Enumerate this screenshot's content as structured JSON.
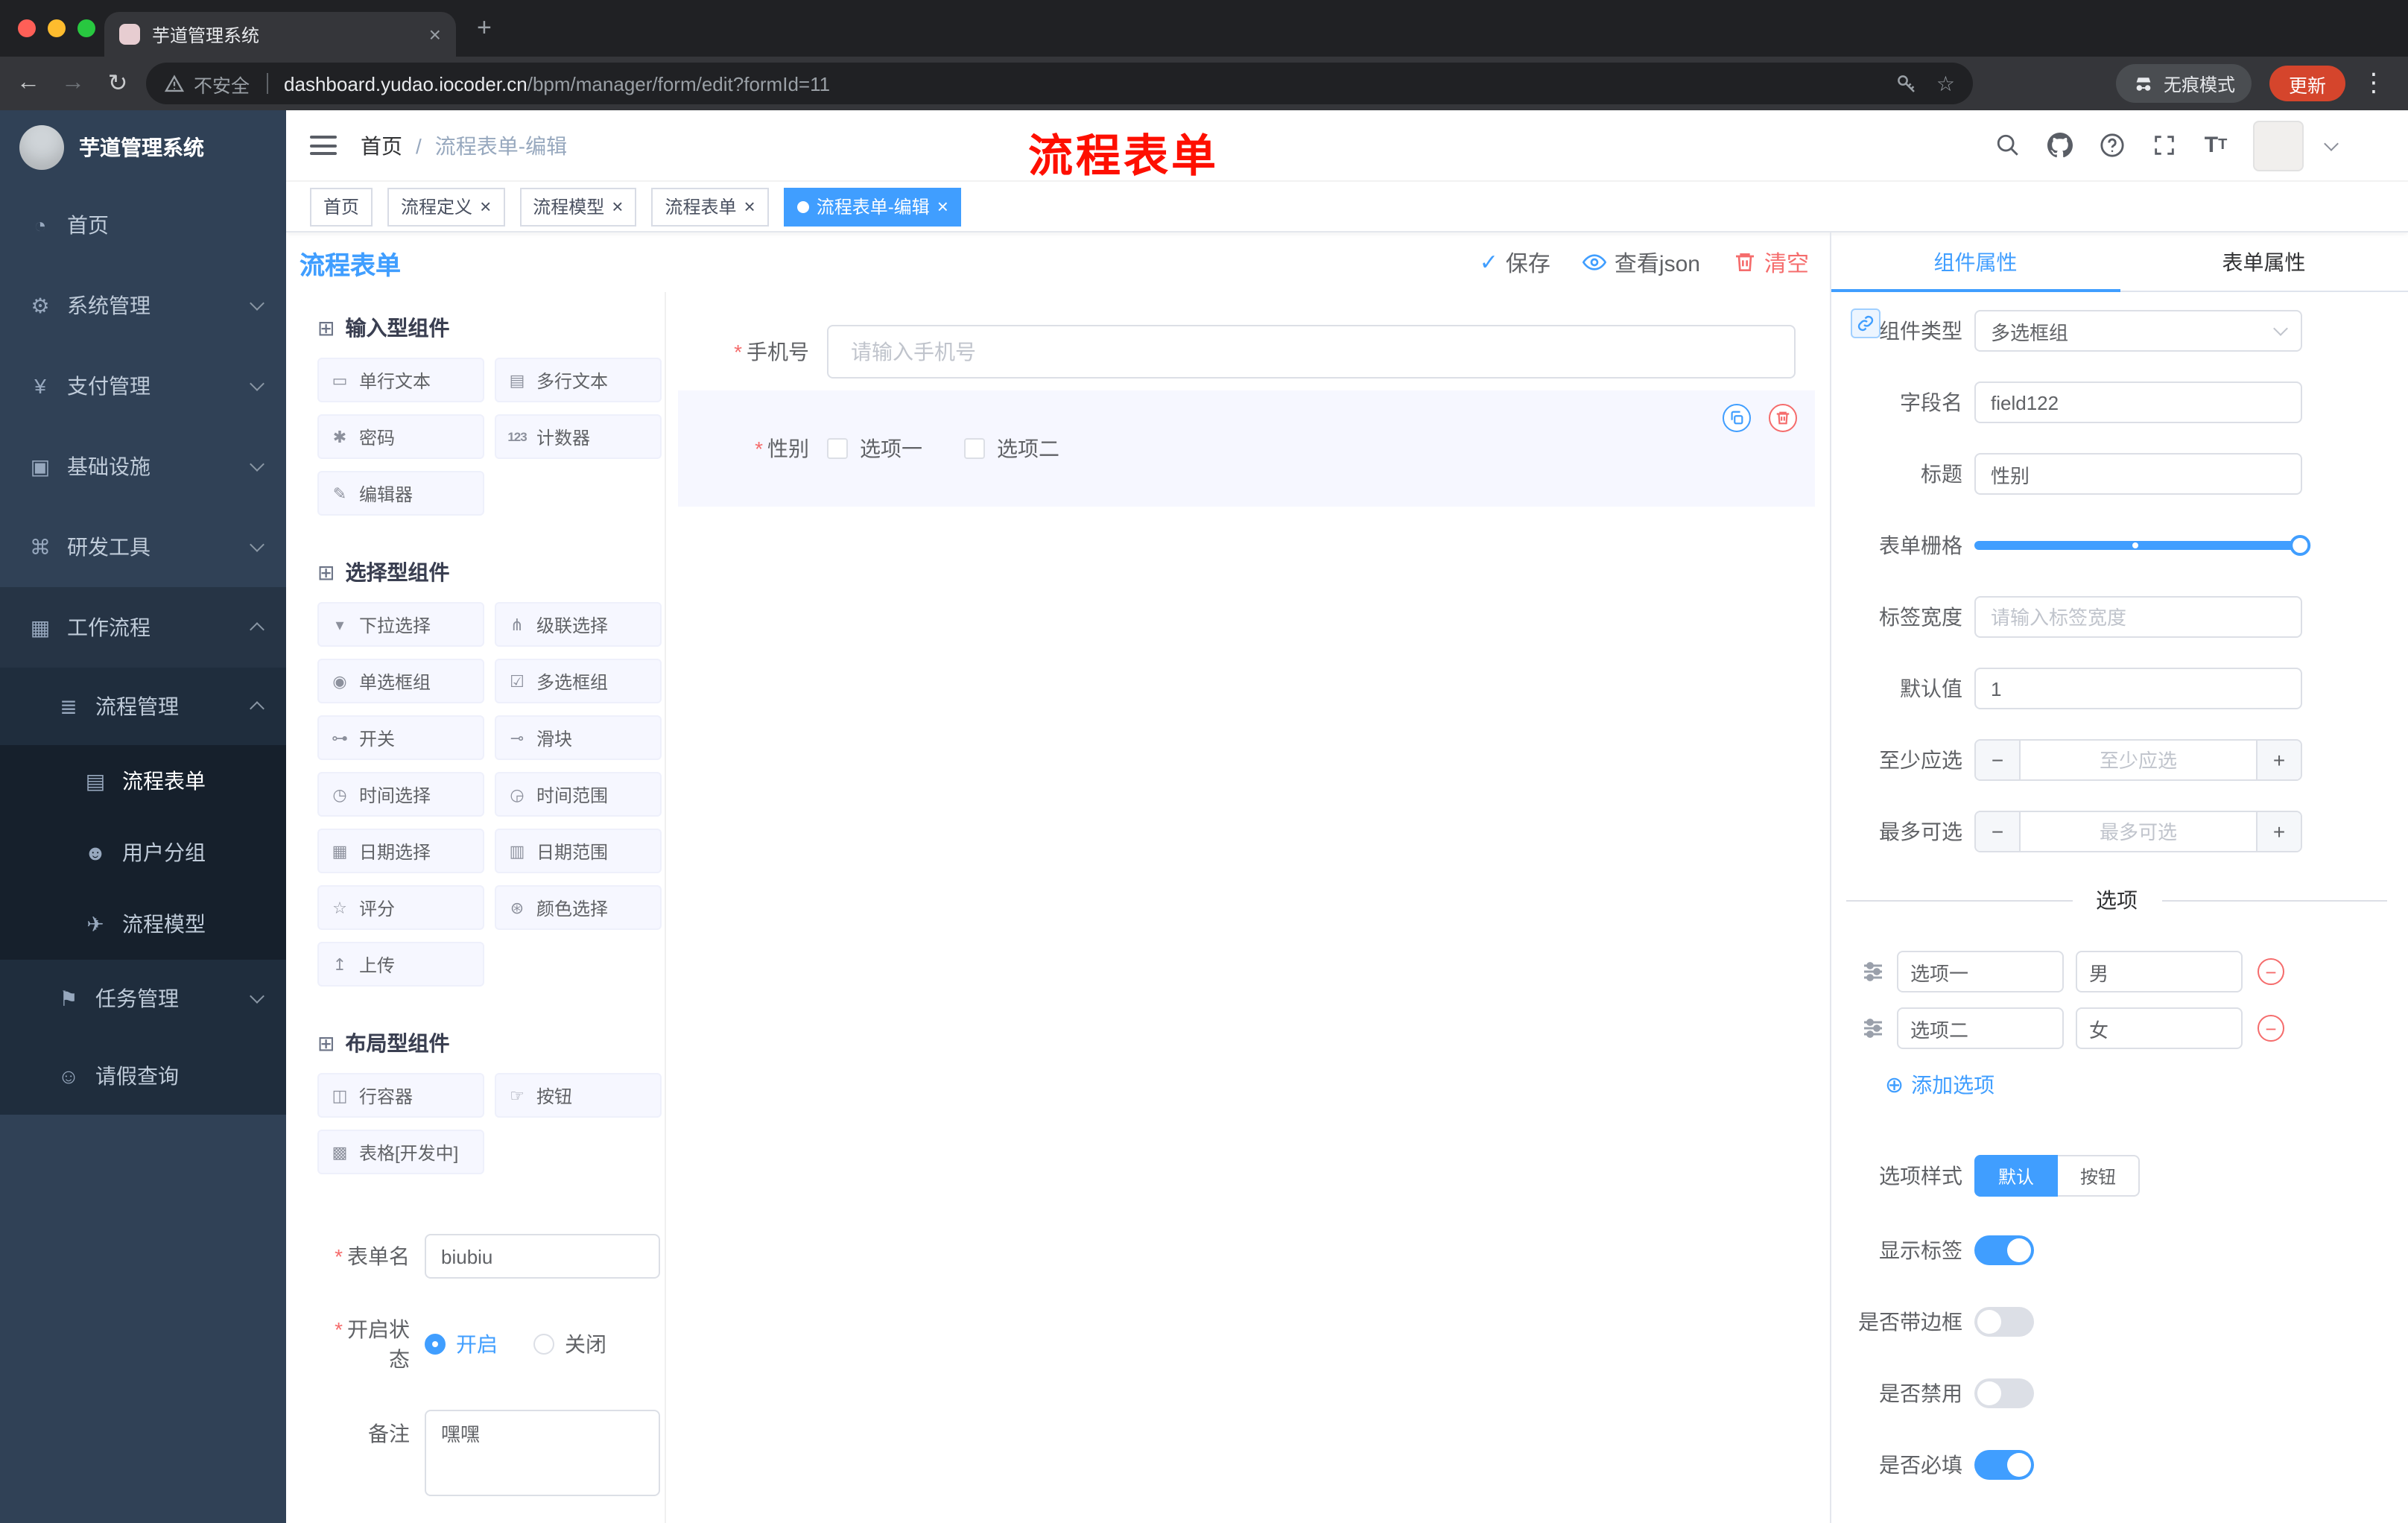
{
  "colors": {
    "primary": "#409eff",
    "danger": "#f56c6c",
    "sidebar": "#304156",
    "annotation": "#fe0f00"
  },
  "icons": {
    "close": "×",
    "new_tab": "+",
    "back": "←",
    "forward": "→",
    "reload": "↻",
    "star": "☆",
    "menu_dots": "⋮",
    "check": "✓",
    "minus": "−",
    "plus": "+",
    "add_circle": "⊕",
    "component_group": "⊞",
    "required": "*",
    "font_size": "T"
  },
  "browser": {
    "tab_title": "芋道管理系统",
    "security_label": "不安全",
    "url_host": "dashboard.yudao.iocoder.cn",
    "url_path": "/bpm/manager/form/edit?formId=11",
    "incognito_label": "无痕模式",
    "update_label": "更新"
  },
  "sidebar": {
    "title": "芋道管理系统",
    "items": [
      {
        "label": "首页",
        "icon": "◔"
      },
      {
        "label": "系统管理",
        "icon": "⚙"
      },
      {
        "label": "支付管理",
        "icon": "¥"
      },
      {
        "label": "基础设施",
        "icon": "▣"
      },
      {
        "label": "研发工具",
        "icon": "⌘"
      },
      {
        "label": "工作流程",
        "icon": "▦"
      },
      {
        "label": "流程管理",
        "icon": "≣"
      },
      {
        "label": "流程表单",
        "icon": "▤"
      },
      {
        "label": "用户分组",
        "icon": "☻"
      },
      {
        "label": "流程模型",
        "icon": "✈"
      },
      {
        "label": "任务管理",
        "icon": "⚑"
      },
      {
        "label": "请假查询",
        "icon": "☺"
      }
    ]
  },
  "header": {
    "breadcrumb_home": "首页",
    "breadcrumb_sep": "/",
    "breadcrumb_current": "流程表单-编辑",
    "annotation": "流程表单"
  },
  "tags": [
    {
      "label": "首页"
    },
    {
      "label": "流程定义"
    },
    {
      "label": "流程模型"
    },
    {
      "label": "流程表单"
    },
    {
      "label": "流程表单-编辑"
    }
  ],
  "designer": {
    "panel_title": "流程表单",
    "actions": {
      "save": "保存",
      "view_json": "查看json",
      "clear": "清空"
    },
    "palette_groups": [
      {
        "title": "输入型组件",
        "items": [
          {
            "label": "单行文本",
            "icon": "▭"
          },
          {
            "label": "多行文本",
            "icon": "▤"
          },
          {
            "label": "密码",
            "icon": "✱"
          },
          {
            "label": "计数器",
            "icon": "123"
          },
          {
            "label": "编辑器",
            "icon": "✎"
          }
        ]
      },
      {
        "title": "选择型组件",
        "items": [
          {
            "label": "下拉选择",
            "icon": "▾"
          },
          {
            "label": "级联选择",
            "icon": "⋔"
          },
          {
            "label": "单选框组",
            "icon": "◉"
          },
          {
            "label": "多选框组",
            "icon": "☑"
          },
          {
            "label": "开关",
            "icon": "⊶"
          },
          {
            "label": "滑块",
            "icon": "⊸"
          },
          {
            "label": "时间选择",
            "icon": "◷"
          },
          {
            "label": "时间范围",
            "icon": "◶"
          },
          {
            "label": "日期选择",
            "icon": "▦"
          },
          {
            "label": "日期范围",
            "icon": "▥"
          },
          {
            "label": "评分",
            "icon": "☆"
          },
          {
            "label": "颜色选择",
            "icon": "⊛"
          },
          {
            "label": "上传",
            "icon": "↥"
          }
        ]
      },
      {
        "title": "布局型组件",
        "items": [
          {
            "label": "行容器",
            "icon": "◫"
          },
          {
            "label": "按钮",
            "icon": "☞"
          },
          {
            "label": "表格[开发中]",
            "icon": "▩"
          }
        ]
      }
    ],
    "meta": {
      "form_name_label": "表单名",
      "form_name_value": "biubiu",
      "status_label": "开启状态",
      "status_on": "开启",
      "status_off": "关闭",
      "remark_label": "备注",
      "remark_value": "嘿嘿"
    },
    "canvas": {
      "phone_label": "手机号",
      "phone_placeholder": "请输入手机号",
      "gender_label": "性别",
      "gender_option1": "选项一",
      "gender_option2": "选项二"
    },
    "props": {
      "tab_component": "组件属性",
      "tab_form": "表单属性",
      "component_type_label": "组件类型",
      "component_type_value": "多选框组",
      "field_name_label": "字段名",
      "field_name_value": "field122",
      "title_label": "标题",
      "title_value": "性别",
      "grid_label": "表单栅格",
      "grid_value_percent": 100,
      "label_width_label": "标签宽度",
      "label_width_placeholder": "请输入标签宽度",
      "default_label": "默认值",
      "default_value": "1",
      "min_label": "至少应选",
      "min_placeholder": "至少应选",
      "max_label": "最多可选",
      "max_placeholder": "最多可选",
      "options_title": "选项",
      "options": [
        {
          "label": "选项一",
          "value": "男"
        },
        {
          "label": "选项二",
          "value": "女"
        }
      ],
      "add_option": "添加选项",
      "style_label": "选项样式",
      "style_default": "默认",
      "style_button": "按钮",
      "toggle_show_label": "显示标签",
      "toggle_border": "是否带边框",
      "toggle_disabled": "是否禁用",
      "toggle_required": "是否必填"
    }
  }
}
